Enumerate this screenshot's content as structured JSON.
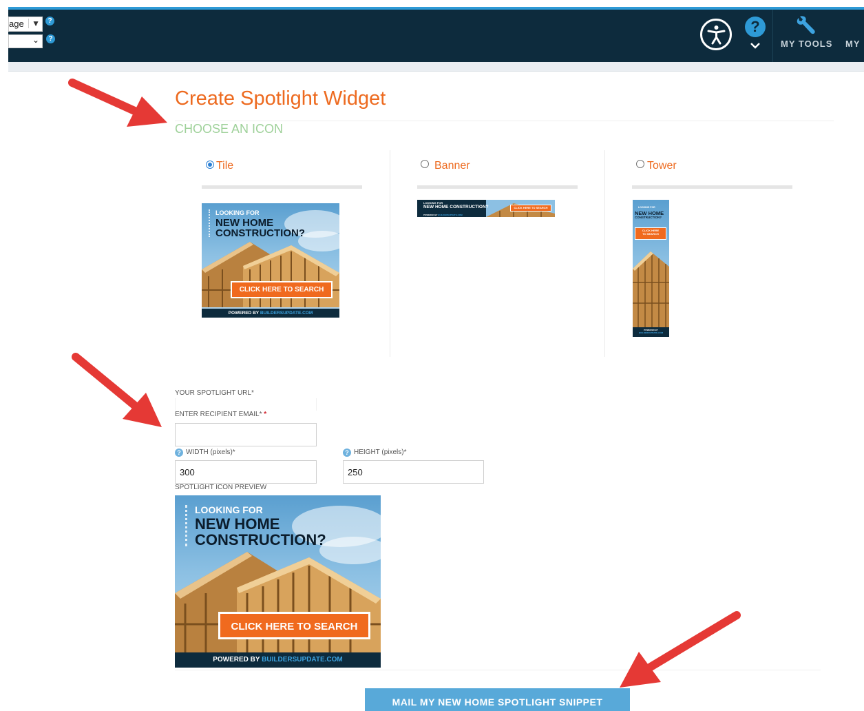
{
  "header": {
    "language_select_value": "age",
    "accessibility_label": "",
    "tools_label": "MY TOOLS",
    "my_label": "MY"
  },
  "page": {
    "title": "Create Spotlight Widget",
    "section_heading": "CHOOSE AN ICON"
  },
  "icon_options": [
    {
      "label": "Tile",
      "selected": true
    },
    {
      "label": "Banner",
      "selected": false
    },
    {
      "label": "Tower",
      "selected": false
    }
  ],
  "ad": {
    "looking_for": "LOOKING FOR",
    "headline_line1": "NEW HOME",
    "headline_line2": "CONSTRUCTION?",
    "banner_headline": "NEW HOME CONSTRUCTION?",
    "cta": "CLICK HERE TO SEARCH",
    "cta_tower_line1": "CLICK HERE",
    "cta_tower_line2": "TO SEARCH",
    "powered_by": "POWERED BY",
    "brand": "BUILDERSUPDATE.COM"
  },
  "form": {
    "spotlight_url_label": "YOUR SPOTLIGHT URL*",
    "recipient_email_label": "ENTER RECIPIENT EMAIL*",
    "recipient_email_required_marker": "*",
    "recipient_email_value": "",
    "width_label": "WIDTH (pixels)*",
    "width_value": "300",
    "height_label": "HEIGHT (pixels)*",
    "height_value": "250",
    "preview_label": "SPOTLIGHT ICON PREVIEW"
  },
  "actions": {
    "mail_button": "MAIL MY NEW HOME SPOTLIGHT SNIPPET"
  },
  "colors": {
    "header_bg": "#0d2b3d",
    "accent_blue": "#2e9ad6",
    "title_orange": "#ed6a1f",
    "section_green": "#9fd19a",
    "button_blue": "#58a9d9",
    "arrow_red": "#e53935"
  }
}
